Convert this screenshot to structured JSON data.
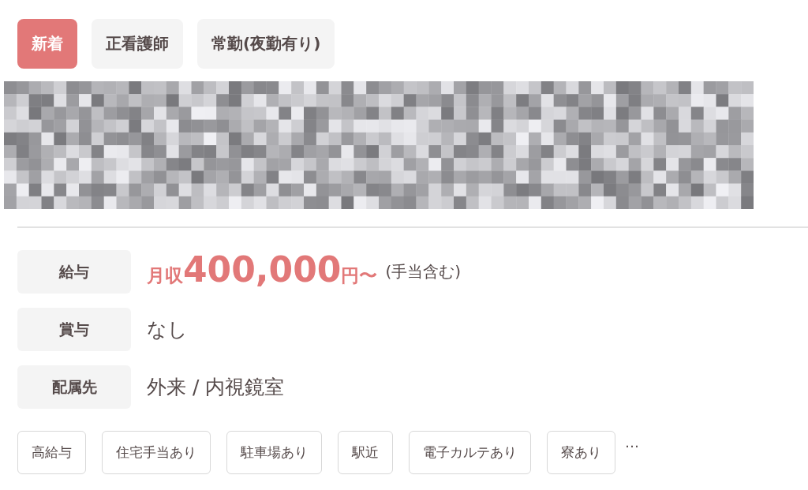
{
  "badges": [
    {
      "label": "新着",
      "kind": "new"
    },
    {
      "label": "正看護師",
      "kind": "plain"
    },
    {
      "label": "常勤(夜勤有り)",
      "kind": "plain"
    }
  ],
  "details": [
    {
      "label": "給与",
      "kind": "salary",
      "prefix": "月収",
      "amount": "400,000",
      "unit": "円〜",
      "note": "(手当含む)"
    },
    {
      "label": "賞与",
      "kind": "text",
      "value": "なし"
    },
    {
      "label": "配属先",
      "kind": "text",
      "value": "外来 / 内視鏡室"
    }
  ],
  "features": [
    "高給与",
    "住宅手当あり",
    "駐車場あり",
    "駅近",
    "電子カルテあり",
    "寮あり"
  ],
  "more": "…"
}
